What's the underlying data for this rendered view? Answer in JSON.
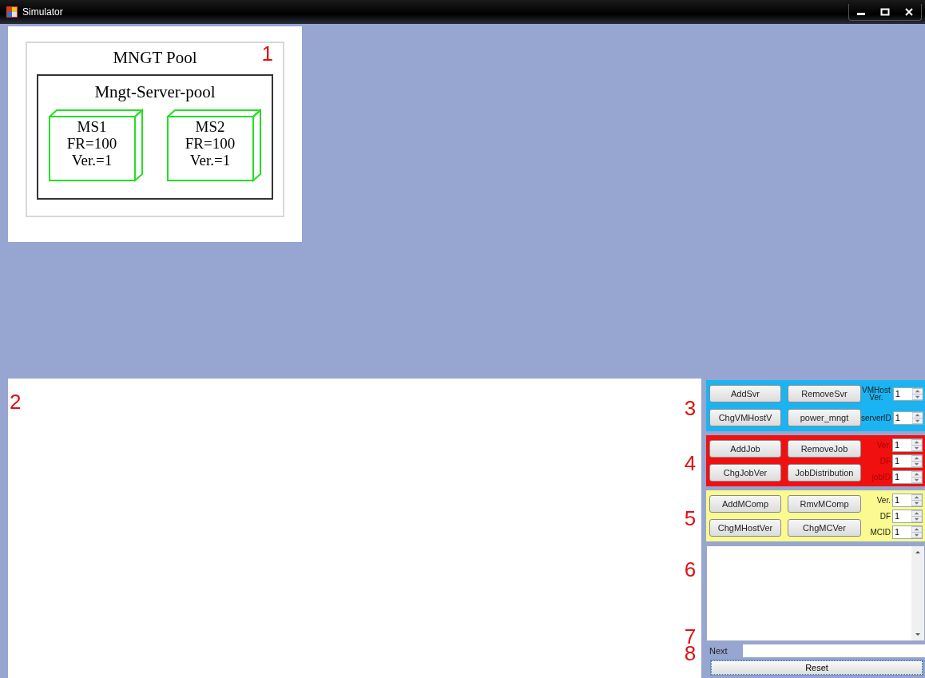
{
  "window": {
    "title": "Simulator"
  },
  "diagram": {
    "marker": "1",
    "pool_title": "MNGT Pool",
    "server_pool_title": "Mngt-Server-pool",
    "servers": [
      {
        "name": "MS1",
        "fr": "FR=100",
        "ver": "Ver.=1"
      },
      {
        "name": "MS2",
        "fr": "FR=100",
        "ver": "Ver.=1"
      }
    ]
  },
  "log_area": {
    "marker": "2"
  },
  "panels": [
    {
      "marker": "3",
      "color": "#1ab4f2",
      "kind": "server",
      "buttons": [
        "AddSvr",
        "RemoveSvr",
        "ChgVMHostV",
        "power_mngt"
      ],
      "fields": [
        {
          "label": "VMHost Ver.",
          "value": "1"
        },
        {
          "label": "serverID",
          "value": "1"
        }
      ]
    },
    {
      "marker": "4",
      "color": "#f01010",
      "kind": "job",
      "buttons": [
        "AddJob",
        "RemoveJob",
        "ChgJobVer",
        "JobDistribution"
      ],
      "fields": [
        {
          "label": "Ver.",
          "value": "1"
        },
        {
          "label": "DF",
          "value": "1"
        },
        {
          "label": "jobID",
          "value": "1"
        }
      ]
    },
    {
      "marker": "5",
      "color": "#fafa90",
      "kind": "component",
      "buttons": [
        "AddMComp",
        "RmvMComp",
        "ChgMHostVer",
        "ChgMCVer"
      ],
      "fields": [
        {
          "label": "Ver.",
          "value": "1"
        },
        {
          "label": "DF",
          "value": "1"
        },
        {
          "label": "MCID",
          "value": "1"
        }
      ]
    }
  ],
  "output": {
    "marker": "6"
  },
  "next": {
    "marker": "7",
    "label": "Next"
  },
  "reset": {
    "marker": "8",
    "label": "Reset"
  }
}
